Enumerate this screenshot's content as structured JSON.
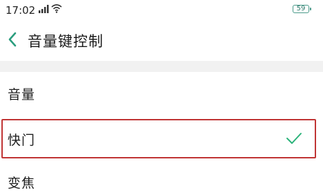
{
  "status_bar": {
    "time": "17:02",
    "battery": "59"
  },
  "header": {
    "title": "音量键控制"
  },
  "options": [
    {
      "label": "音量",
      "selected": false
    },
    {
      "label": "快门",
      "selected": true
    },
    {
      "label": "变焦",
      "selected": false
    }
  ],
  "colors": {
    "accent_check": "#2bb37a",
    "highlight_border": "#c03434",
    "back_arrow": "#2a9d7e",
    "battery": "#4a9a8a"
  },
  "icons": [
    "signal-icon",
    "wifi-icon",
    "battery-icon",
    "back-arrow-icon",
    "checkmark-icon"
  ]
}
